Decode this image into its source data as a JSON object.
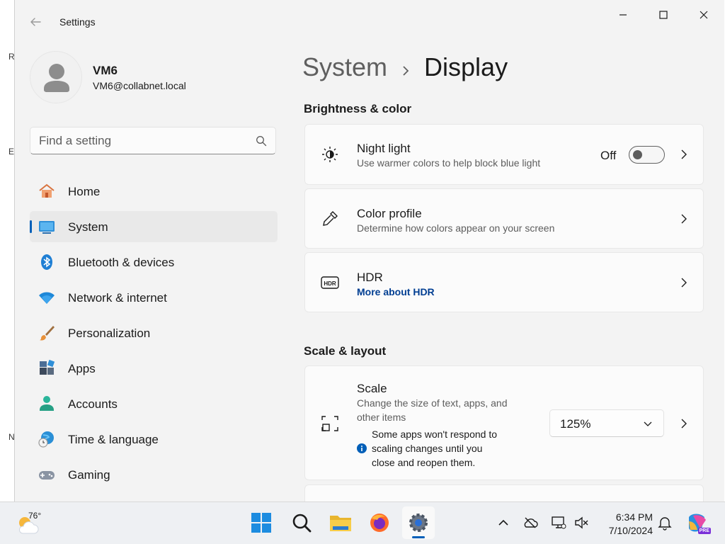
{
  "window": {
    "title": "Settings",
    "controls": {
      "minimize": "minimize-icon",
      "maximize": "maximize-icon",
      "close": "close-icon"
    }
  },
  "desktop": {
    "edge_letters": [
      "R",
      "E",
      "N"
    ]
  },
  "user": {
    "name": "VM6",
    "email": "VM6@collabnet.local"
  },
  "search": {
    "placeholder": "Find a setting"
  },
  "sidebar": {
    "items": [
      {
        "label": "Home",
        "icon": "home-icon"
      },
      {
        "label": "System",
        "icon": "system-icon",
        "selected": true
      },
      {
        "label": "Bluetooth & devices",
        "icon": "bluetooth-icon"
      },
      {
        "label": "Network & internet",
        "icon": "wifi-icon"
      },
      {
        "label": "Personalization",
        "icon": "brush-icon"
      },
      {
        "label": "Apps",
        "icon": "apps-icon"
      },
      {
        "label": "Accounts",
        "icon": "accounts-icon"
      },
      {
        "label": "Time & language",
        "icon": "globe-clock-icon"
      },
      {
        "label": "Gaming",
        "icon": "gamepad-icon"
      }
    ]
  },
  "breadcrumb": {
    "parent": "System",
    "separator": "›",
    "current": "Display"
  },
  "sections": {
    "brightness": {
      "title": "Brightness & color",
      "night_light": {
        "title": "Night light",
        "subtitle": "Use warmer colors to help block blue light",
        "state_label": "Off",
        "enabled": false
      },
      "color_profile": {
        "title": "Color profile",
        "subtitle": "Determine how colors appear on your screen"
      },
      "hdr": {
        "title": "HDR",
        "link": "More about HDR"
      }
    },
    "scale_layout": {
      "title": "Scale & layout",
      "scale": {
        "title": "Scale",
        "subtitle_line1": "Change the size of text, apps, and",
        "subtitle_line2": "other items",
        "note_line1": "Some apps won't respond to",
        "note_line2": "scaling changes until you",
        "note_line3": "close and reopen them.",
        "value": "125%"
      }
    }
  },
  "taskbar": {
    "weather_temp": "76°",
    "apps": [
      "start-icon",
      "search-icon",
      "file-explorer-icon",
      "firefox-icon",
      "settings-icon"
    ],
    "active_app": "settings-icon",
    "tray": [
      "chevron-up-icon",
      "onedrive-icon",
      "network-icon",
      "volume-muted-icon"
    ],
    "time": "6:34 PM",
    "date": "7/10/2024",
    "copilot_badge": "PRE"
  },
  "colors": {
    "accent": "#005fb8",
    "link": "#003e92",
    "window_bg": "#f3f3f3",
    "card_bg": "#fbfbfb"
  }
}
